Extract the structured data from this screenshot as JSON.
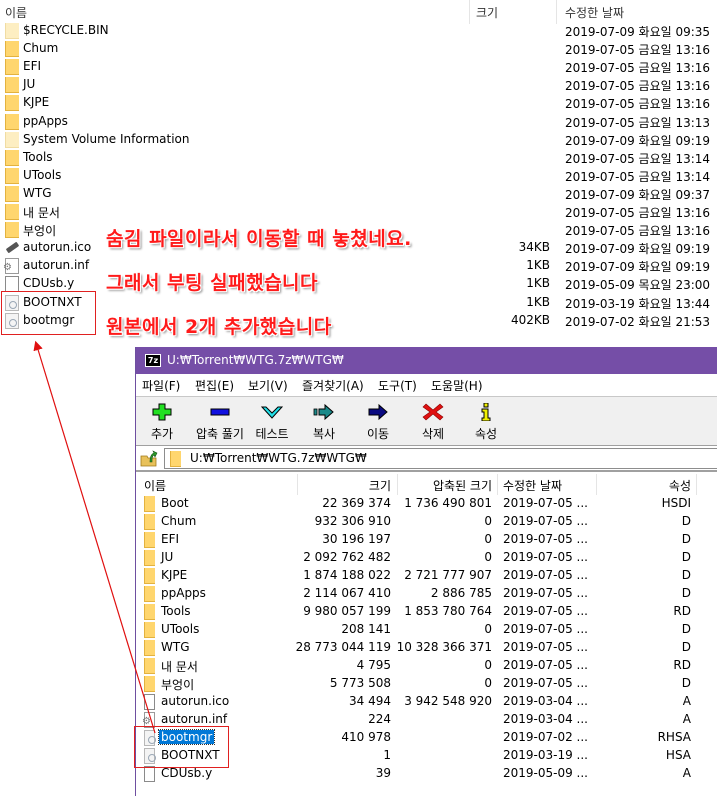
{
  "explorer": {
    "columns": {
      "name": "이름",
      "size": "크기",
      "modified": "수정한 날짜"
    },
    "items": [
      {
        "name": "$RECYCLE.BIN",
        "size": "",
        "modified": "2019-07-09 화요일 09:35",
        "icon": "folder-hidden-icon"
      },
      {
        "name": "Chum",
        "size": "",
        "modified": "2019-07-05 금요일 13:16",
        "icon": "folder-icon"
      },
      {
        "name": "EFI",
        "size": "",
        "modified": "2019-07-05 금요일 13:16",
        "icon": "folder-icon"
      },
      {
        "name": "JU",
        "size": "",
        "modified": "2019-07-05 금요일 13:16",
        "icon": "folder-icon"
      },
      {
        "name": "KJPE",
        "size": "",
        "modified": "2019-07-05 금요일 13:16",
        "icon": "folder-icon"
      },
      {
        "name": "ppApps",
        "size": "",
        "modified": "2019-07-05 금요일 13:13",
        "icon": "folder-icon"
      },
      {
        "name": "System Volume Information",
        "size": "",
        "modified": "2019-07-09 화요일 09:19",
        "icon": "folder-hidden-icon"
      },
      {
        "name": "Tools",
        "size": "",
        "modified": "2019-07-05 금요일 13:14",
        "icon": "folder-icon"
      },
      {
        "name": "UTools",
        "size": "",
        "modified": "2019-07-05 금요일 13:14",
        "icon": "folder-icon"
      },
      {
        "name": "WTG",
        "size": "",
        "modified": "2019-07-09 화요일 09:37",
        "icon": "folder-icon"
      },
      {
        "name": "내 문서",
        "size": "",
        "modified": "2019-07-05 금요일 13:16",
        "icon": "folder-icon"
      },
      {
        "name": "부엉이",
        "size": "",
        "modified": "2019-07-05 금요일 13:16",
        "icon": "folder-icon"
      },
      {
        "name": "autorun.ico",
        "size": "34KB",
        "modified": "2019-07-09 화요일 09:19",
        "icon": "usb-drive-icon"
      },
      {
        "name": "autorun.inf",
        "size": "1KB",
        "modified": "2019-07-09 화요일 09:19",
        "icon": "settings-file-icon"
      },
      {
        "name": "CDUsb.y",
        "size": "1KB",
        "modified": "2019-05-09 목요일 23:00",
        "icon": "file-icon"
      },
      {
        "name": "BOOTNXT",
        "size": "1KB",
        "modified": "2019-03-19 화요일 13:44",
        "icon": "system-file-icon"
      },
      {
        "name": "bootmgr",
        "size": "402KB",
        "modified": "2019-07-02 화요일 21:53",
        "icon": "system-file-icon"
      }
    ]
  },
  "annotations": {
    "line1": "숨김 파일이라서 이동할 때 놓쳤네요.",
    "line2": "그래서 부팅 실패했습니다",
    "line3": "원본에서 2개 추가했습니다",
    "color": "#ff1a1a"
  },
  "sevenzip": {
    "logo": "7z",
    "title": "U:₩Torrent₩WTG.7z₩WTG₩",
    "title_color": "#754ea7",
    "menu": [
      "파일(F)",
      "편집(E)",
      "보기(V)",
      "즐겨찾기(A)",
      "도구(T)",
      "도움말(H)"
    ],
    "toolbar": [
      {
        "label": "추가",
        "icon": "add-icon"
      },
      {
        "label": "압축 풀기",
        "icon": "extract-icon"
      },
      {
        "label": "테스트",
        "icon": "test-icon"
      },
      {
        "label": "복사",
        "icon": "copy-icon"
      },
      {
        "label": "이동",
        "icon": "move-icon"
      },
      {
        "label": "삭제",
        "icon": "delete-icon"
      },
      {
        "label": "속성",
        "icon": "info-icon"
      }
    ],
    "address": "U:₩Torrent₩WTG.7z₩WTG₩",
    "columns": {
      "name": "이름",
      "size": "크기",
      "packed": "압축된 크기",
      "modified": "수정한 날짜",
      "attributes": "속성"
    },
    "items": [
      {
        "name": "Boot",
        "size": "22 369 374",
        "packed": "1 736 490 801",
        "modified": "2019-07-05 ...",
        "attr": "HSDI",
        "icon": "folder-icon"
      },
      {
        "name": "Chum",
        "size": "932 306 910",
        "packed": "0",
        "modified": "2019-07-05 ...",
        "attr": "D",
        "icon": "folder-icon"
      },
      {
        "name": "EFI",
        "size": "30 196 197",
        "packed": "0",
        "modified": "2019-07-05 ...",
        "attr": "D",
        "icon": "folder-icon"
      },
      {
        "name": "JU",
        "size": "2 092 762 482",
        "packed": "0",
        "modified": "2019-07-05 ...",
        "attr": "D",
        "icon": "folder-icon"
      },
      {
        "name": "KJPE",
        "size": "1 874 188 022",
        "packed": "2 721 777 907",
        "modified": "2019-07-05 ...",
        "attr": "D",
        "icon": "folder-icon"
      },
      {
        "name": "ppApps",
        "size": "2 114 067 410",
        "packed": "2 886 785",
        "modified": "2019-07-05 ...",
        "attr": "D",
        "icon": "folder-icon"
      },
      {
        "name": "Tools",
        "size": "9 980 057 199",
        "packed": "1 853 780 764",
        "modified": "2019-07-05 ...",
        "attr": "RD",
        "icon": "folder-icon"
      },
      {
        "name": "UTools",
        "size": "208 141",
        "packed": "0",
        "modified": "2019-07-05 ...",
        "attr": "D",
        "icon": "folder-icon"
      },
      {
        "name": "WTG",
        "size": "28 773 044 119",
        "packed": "10 328 366 371",
        "modified": "2019-07-05 ...",
        "attr": "D",
        "icon": "folder-icon"
      },
      {
        "name": "내 문서",
        "size": "4 795",
        "packed": "0",
        "modified": "2019-07-05 ...",
        "attr": "RD",
        "icon": "folder-icon"
      },
      {
        "name": "부엉이",
        "size": "5 773 508",
        "packed": "0",
        "modified": "2019-07-05 ...",
        "attr": "D",
        "icon": "folder-icon"
      },
      {
        "name": "autorun.ico",
        "size": "34 494",
        "packed": "3 942 548 920",
        "modified": "2019-03-04 ...",
        "attr": "A",
        "icon": "file-icon"
      },
      {
        "name": "autorun.inf",
        "size": "224",
        "packed": "",
        "modified": "2019-03-04 ...",
        "attr": "A",
        "icon": "settings-file-icon"
      },
      {
        "name": "bootmgr",
        "size": "410 978",
        "packed": "",
        "modified": "2019-07-02 ...",
        "attr": "RHSA",
        "icon": "system-file-icon",
        "selected": true
      },
      {
        "name": "BOOTNXT",
        "size": "1",
        "packed": "",
        "modified": "2019-03-19 ...",
        "attr": "HSA",
        "icon": "system-file-icon"
      },
      {
        "name": "CDUsb.y",
        "size": "39",
        "packed": "",
        "modified": "2019-05-09 ...",
        "attr": "A",
        "icon": "file-icon"
      }
    ]
  }
}
